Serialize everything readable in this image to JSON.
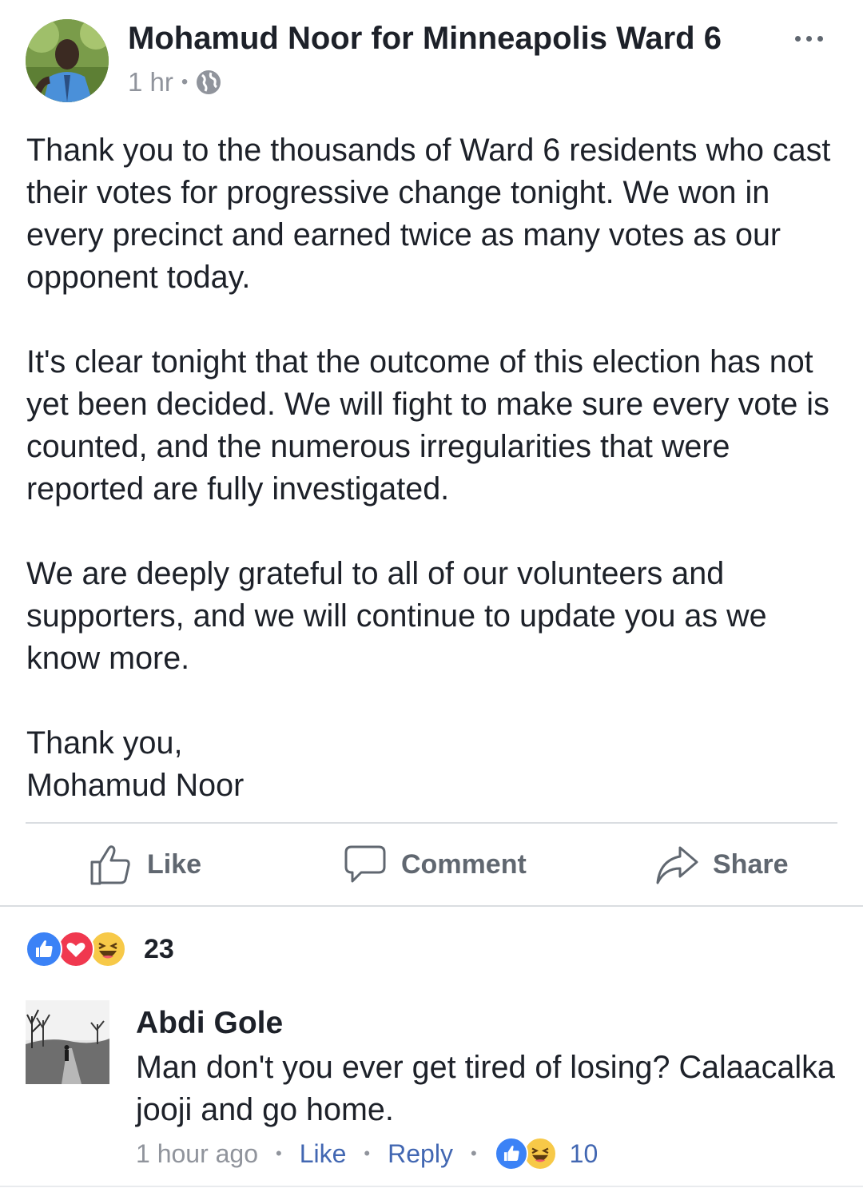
{
  "post": {
    "author": "Mohamud Noor for Minneapolis Ward 6",
    "time": "1 hr",
    "dot": "•",
    "privacy_icon": "globe-icon",
    "more_icon": "more-icon",
    "paragraphs": [
      "Thank you to the thousands of Ward 6 residents who cast their votes for progressive change tonight. We won in every precinct and earned twice as many votes as our opponent today.",
      "It's clear tonight that the outcome of this election has not yet been decided. We will fight to make sure every vote is counted, and the numerous irregularities that were reported are fully investigated.",
      "We are deeply grateful to all of our volunteers and supporters, and we will continue to update you as we know more.",
      "Thank you,\nMohamud Noor"
    ]
  },
  "actions": {
    "like": "Like",
    "comment": "Comment",
    "share": "Share"
  },
  "reactions": {
    "icons": [
      "like-reaction",
      "love-reaction",
      "haha-reaction"
    ],
    "count": "23"
  },
  "comment": {
    "author": "Abdi Gole",
    "text": "Man don't you ever get tired of losing? Calaacalka jooji and go home.",
    "time": "1 hour ago",
    "like": "Like",
    "reply": "Reply",
    "sep": "•",
    "reaction_icons": [
      "like-reaction",
      "haha-reaction"
    ],
    "reaction_count": "10"
  },
  "colors": {
    "text": "#1d2129",
    "secondary": "#90949c",
    "action": "#606770",
    "link": "#4267b2",
    "like_blue": "#3b82f6",
    "love_red": "#f0384f",
    "haha_yellow": "#f7c948"
  }
}
